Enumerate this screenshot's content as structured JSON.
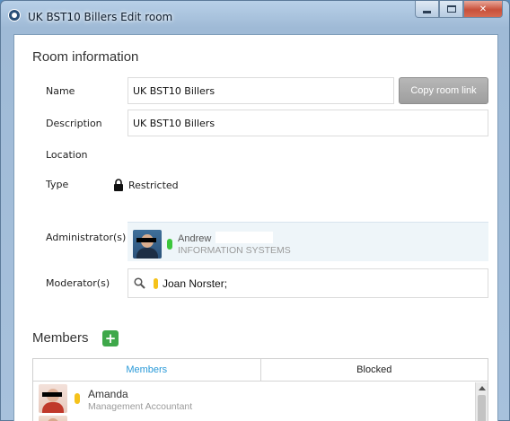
{
  "window": {
    "title": "UK BST10 Billers Edit room"
  },
  "room_info": {
    "section_title": "Room information",
    "name_label": "Name",
    "name_value": "UK BST10 Billers",
    "copy_link_label": "Copy room link",
    "description_label": "Description",
    "description_value": "UK BST10 Billers",
    "location_label": "Location",
    "type_label": "Type",
    "type_value": "Restricted",
    "administrators_label": "Administrator(s)",
    "administrator": {
      "name": "Andrew",
      "department": "INFORMATION SYSTEMS",
      "status_color": "#3cc63c"
    },
    "moderators_label": "Moderator(s)",
    "moderator_value": "Joan Norster;",
    "moderator_status_color": "#f5c21b"
  },
  "members": {
    "section_title": "Members",
    "add_icon": "plus-icon",
    "tabs": [
      {
        "label": "Members",
        "active": true
      },
      {
        "label": "Blocked",
        "active": false
      }
    ],
    "list": [
      {
        "name": "Amanda",
        "title": "Management Accountant",
        "status_color": "#f5c21b"
      }
    ]
  },
  "colors": {
    "accent": "#2a9ad8",
    "add_button": "#3ea84a",
    "copy_button": "#a9a9a9"
  }
}
